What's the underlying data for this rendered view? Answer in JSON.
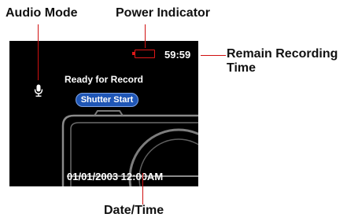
{
  "callouts": {
    "audio_mode": "Audio Mode",
    "power_indicator": "Power Indicator",
    "remain_recording_line1": "Remain Recording",
    "remain_recording_line2": "Time",
    "date_time": "Date/Time"
  },
  "screen": {
    "remain_time": "59:59",
    "status_text": "Ready for Record",
    "shutter_button": "Shutter Start",
    "datetime": "01/01/2003 12:00AM",
    "battery_icon": "battery-empty-icon",
    "mic_icon": "microphone-icon"
  },
  "colors": {
    "screen_bg": "#000000",
    "battery": "#e01818",
    "leader_lines": "#d01010",
    "shutter_button_bg": "#1f56b6"
  }
}
